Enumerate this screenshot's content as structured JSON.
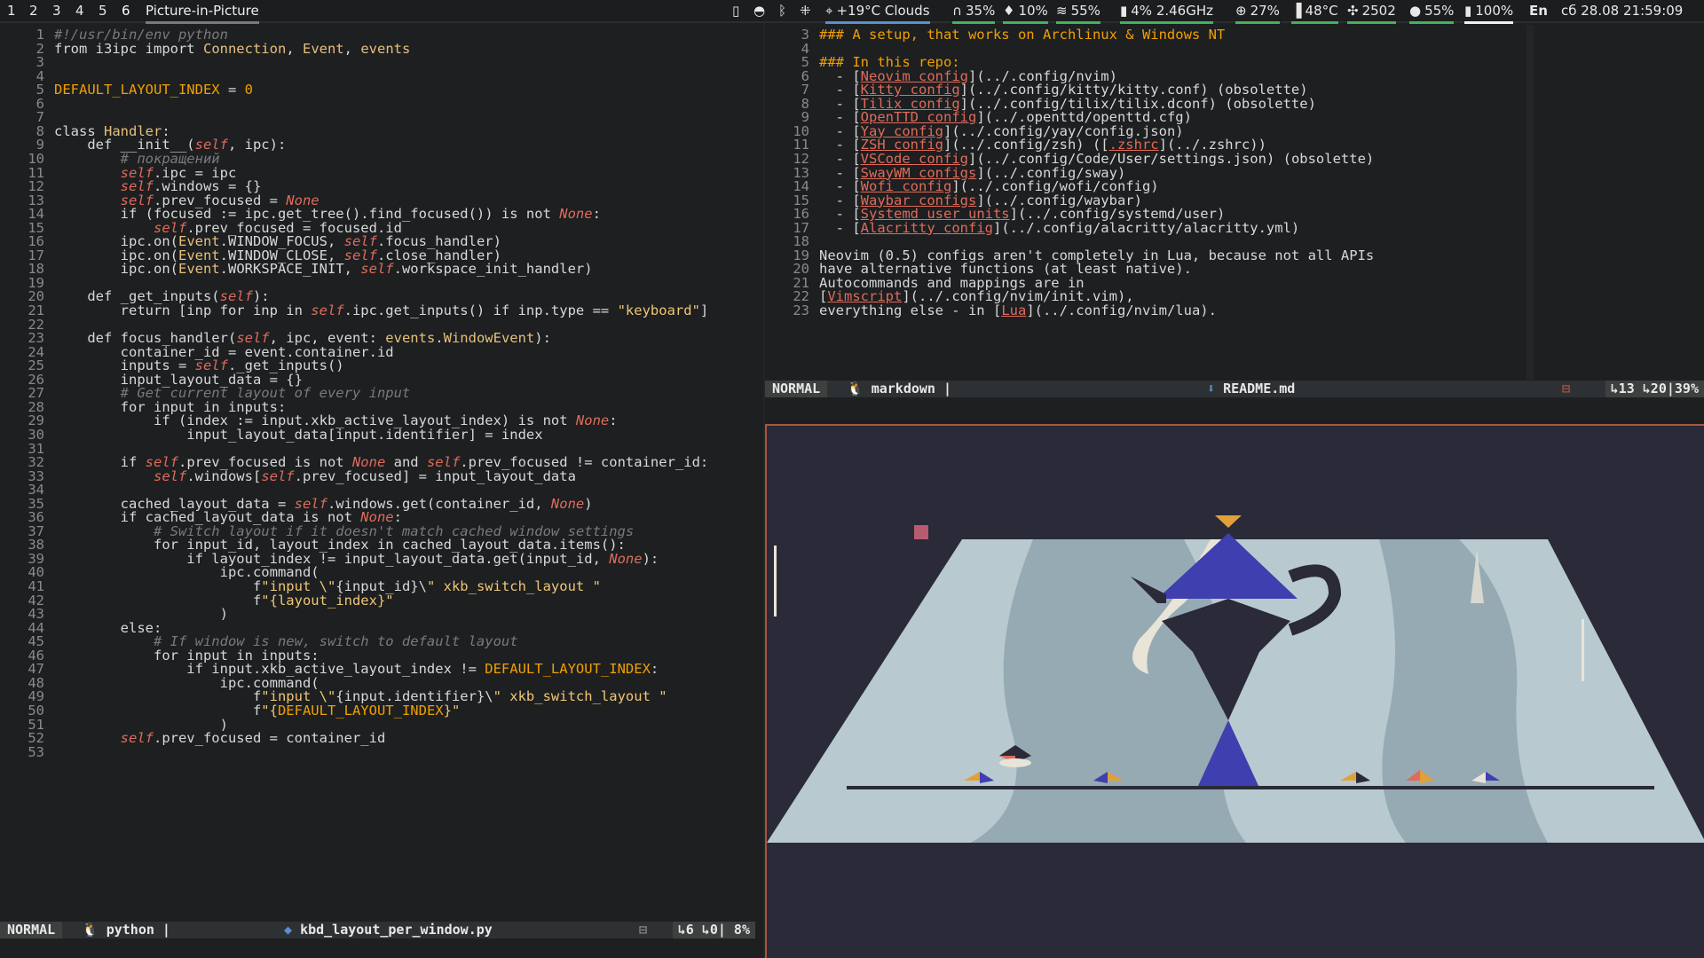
{
  "topbar": {
    "workspaces": [
      "1",
      "2",
      "3",
      "4",
      "5",
      "6"
    ],
    "window_title": "Picture-in-Picture",
    "modules": {
      "weather": "+19°C Clouds",
      "headphones": "35%",
      "mic": "10%",
      "wifi": "55%",
      "cpu": "4% 2.46GHz",
      "memory": "27%",
      "temp": "48°C",
      "fan": "2502",
      "brightness": "55%",
      "battery": "100%",
      "language": "En",
      "datetime": "сб 28.08 21:59:09"
    },
    "colors": {
      "accent_blue": "#5a8fd0",
      "accent_green": "#3fb35a",
      "accent_yellow": "#e0b93a"
    }
  },
  "left_editor": {
    "lines": [
      {
        "n": "1",
        "t": "#!/usr/bin/env python"
      },
      {
        "n": "2",
        "t": "from i3ipc import Connection, Event, events"
      },
      {
        "n": "3",
        "t": ""
      },
      {
        "n": "4",
        "t": ""
      },
      {
        "n": "5",
        "t": "DEFAULT_LAYOUT_INDEX = 0"
      },
      {
        "n": "6",
        "t": ""
      },
      {
        "n": "7",
        "t": ""
      },
      {
        "n": "8",
        "t": "class Handler:"
      },
      {
        "n": "9",
        "t": "    def __init__(self, ipc):"
      },
      {
        "n": "10",
        "t": "        # покращений"
      },
      {
        "n": "11",
        "t": "        self.ipc = ipc"
      },
      {
        "n": "12",
        "t": "        self.windows = {}"
      },
      {
        "n": "13",
        "t": "        self.prev_focused = None"
      },
      {
        "n": "14",
        "t": "        if (focused := ipc.get_tree().find_focused()) is not None:"
      },
      {
        "n": "15",
        "t": "            self.prev_focused = focused.id"
      },
      {
        "n": "16",
        "t": "        ipc.on(Event.WINDOW_FOCUS, self.focus_handler)"
      },
      {
        "n": "17",
        "t": "        ipc.on(Event.WINDOW_CLOSE, self.close_handler)"
      },
      {
        "n": "18",
        "t": "        ipc.on(Event.WORKSPACE_INIT, self.workspace_init_handler)"
      },
      {
        "n": "19",
        "t": ""
      },
      {
        "n": "20",
        "t": "    def _get_inputs(self):"
      },
      {
        "n": "21",
        "t": "        return [inp for inp in self.ipc.get_inputs() if inp.type == \"keyboard\"]"
      },
      {
        "n": "22",
        "t": ""
      },
      {
        "n": "23",
        "t": "    def focus_handler(self, ipc, event: events.WindowEvent):"
      },
      {
        "n": "24",
        "t": "        container_id = event.container.id"
      },
      {
        "n": "25",
        "t": "        inputs = self._get_inputs()"
      },
      {
        "n": "26",
        "t": "        input_layout_data = {}"
      },
      {
        "n": "27",
        "t": "        # Get current layout of every input"
      },
      {
        "n": "28",
        "t": "        for input in inputs:"
      },
      {
        "n": "29",
        "t": "            if (index := input.xkb_active_layout_index) is not None:"
      },
      {
        "n": "30",
        "t": "                input_layout_data[input.identifier] = index"
      },
      {
        "n": "31",
        "t": ""
      },
      {
        "n": "32",
        "t": "        if self.prev_focused is not None and self.prev_focused != container_id:"
      },
      {
        "n": "33",
        "t": "            self.windows[self.prev_focused] = input_layout_data"
      },
      {
        "n": "34",
        "t": ""
      },
      {
        "n": "35",
        "t": "        cached_layout_data = self.windows.get(container_id, None)"
      },
      {
        "n": "36",
        "t": "        if cached_layout_data is not None:"
      },
      {
        "n": "37",
        "t": "            # Switch layout if it doesn't match cached window settings"
      },
      {
        "n": "38",
        "t": "            for input_id, layout_index in cached_layout_data.items():"
      },
      {
        "n": "39",
        "t": "                if layout_index != input_layout_data.get(input_id, None):"
      },
      {
        "n": "40",
        "t": "                    ipc.command("
      },
      {
        "n": "41",
        "t": "                        f\"input \\\"{input_id}\\\" xkb_switch_layout \""
      },
      {
        "n": "42",
        "t": "                        f\"{layout_index}\""
      },
      {
        "n": "43",
        "t": "                    )"
      },
      {
        "n": "44",
        "t": "        else:"
      },
      {
        "n": "45",
        "t": "            # If window is new, switch to default layout"
      },
      {
        "n": "46",
        "t": "            for input in inputs:"
      },
      {
        "n": "47",
        "t": "                if input.xkb_active_layout_index != DEFAULT_LAYOUT_INDEX:"
      },
      {
        "n": "48",
        "t": "                    ipc.command("
      },
      {
        "n": "49",
        "t": "                        f\"input \\\"{input.identifier}\\\" xkb_switch_layout \""
      },
      {
        "n": "50",
        "t": "                        f\"{DEFAULT_LAYOUT_INDEX}\""
      },
      {
        "n": "51",
        "t": "                    )"
      },
      {
        "n": "52",
        "t": "        self.prev_focused = container_id"
      },
      {
        "n": "53",
        "t": ""
      }
    ],
    "status": {
      "mode": "NORMAL",
      "filetype": "python |",
      "filename": "kbd_layout_per_window.py",
      "position": "↳6 ↳0| 8%"
    }
  },
  "right_editor": {
    "lines": [
      {
        "n": "3",
        "t": "### A setup, that works on Archlinux & Windows NT"
      },
      {
        "n": "4",
        "t": ""
      },
      {
        "n": "5",
        "t": "### In this repo:"
      },
      {
        "n": "6",
        "t": "  - [Neovim config](../.config/nvim)"
      },
      {
        "n": "7",
        "t": "  - [Kitty config](../.config/kitty/kitty.conf) (obsolette)"
      },
      {
        "n": "8",
        "t": "  - [Tilix config](../.config/tilix/tilix.dconf) (obsolette)"
      },
      {
        "n": "9",
        "t": "  - [OpenTTD config](../.openttd/openttd.cfg)"
      },
      {
        "n": "10",
        "t": "  - [Yay config](../.config/yay/config.json)"
      },
      {
        "n": "11",
        "t": "  - [ZSH config](../.config/zsh) ([.zshrc](../.zshrc))"
      },
      {
        "n": "12",
        "t": "  - [VSCode config](../.config/Code/User/settings.json) (obsolette)"
      },
      {
        "n": "13",
        "t": "  - [SwayWM configs](../.config/sway)"
      },
      {
        "n": "14",
        "t": "  - [Wofi config](../.config/wofi/config)"
      },
      {
        "n": "15",
        "t": "  - [Waybar configs](../.config/waybar)"
      },
      {
        "n": "16",
        "t": "  - [Systemd user units](../.config/systemd/user)"
      },
      {
        "n": "17",
        "t": "  - [Alacritty config](../.config/alacritty/alacritty.yml)"
      },
      {
        "n": "18",
        "t": ""
      },
      {
        "n": "19",
        "t": "Neovim (0.5) configs aren't completely in Lua, because not all APIs"
      },
      {
        "n": "20",
        "t": "have alternative functions (at least native)."
      },
      {
        "n": "21",
        "t": "Autocommands and mappings are in"
      },
      {
        "n": "22",
        "t": "[Vimscript](../.config/nvim/init.vim),"
      },
      {
        "n": "23",
        "t": "everything else - in [Lua](../.config/nvim/lua)."
      }
    ],
    "status": {
      "mode": "NORMAL",
      "filetype": "markdown |",
      "filename": "README.md",
      "position": "↳13 ↳20|39%"
    }
  },
  "pip_window": {
    "title": "Picture-in-Picture"
  }
}
